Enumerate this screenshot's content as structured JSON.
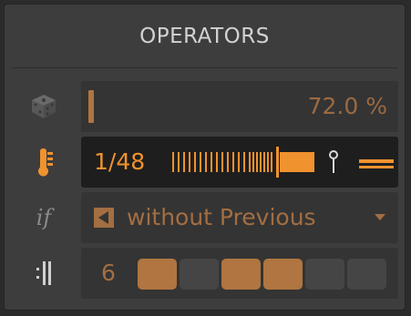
{
  "panel": {
    "title": "OPERATORS"
  },
  "chance": {
    "icon": "dice-icon",
    "value_label": "72.0 %",
    "level": 0.0
  },
  "ratio": {
    "icon": "thermometer-icon",
    "value_label": "1/48",
    "pin_icon": "pin-icon",
    "minus_icon": "minus-icon",
    "accent": "#f0922e"
  },
  "condition": {
    "label_icon": "if-icon",
    "mode_icon": "previous-arrow-icon",
    "value": "without Previous",
    "dropdown_icon": "chevron-down-icon"
  },
  "pattern": {
    "icon": "repeat-bars-icon",
    "count": "6",
    "steps": [
      true,
      false,
      true,
      true,
      false,
      false
    ]
  },
  "colors": {
    "active_orange": "#f0922e",
    "muted_orange": "#a36e42",
    "panel_bg": "#3d3d3d",
    "field_bg": "#343434"
  }
}
